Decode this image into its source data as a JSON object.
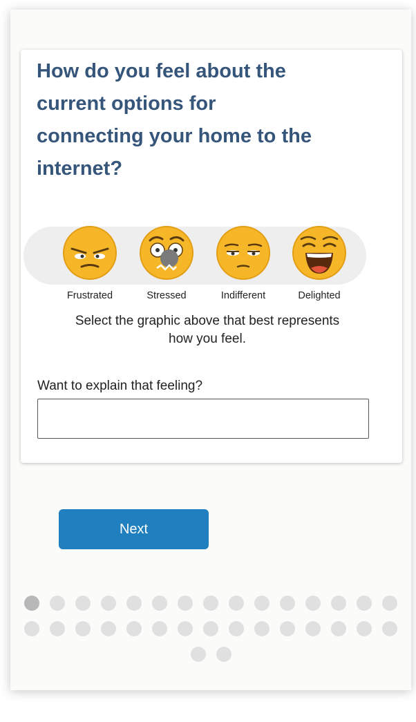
{
  "question": {
    "lines": [
      "How do you feel about the",
      "current options for",
      "connecting your home to the",
      "internet?"
    ]
  },
  "moods": [
    {
      "label": "Frustrated",
      "icon": "frustrated-face-icon"
    },
    {
      "label": "Stressed",
      "icon": "stressed-face-icon"
    },
    {
      "label": "Indifferent",
      "icon": "indifferent-face-icon"
    },
    {
      "label": "Delighted",
      "icon": "delighted-face-icon"
    }
  ],
  "instruction": {
    "line1": "Select the graphic above that best represents",
    "line2": "how you feel."
  },
  "explain": {
    "label": "Want to explain that feeling?",
    "value": ""
  },
  "next_button": {
    "label": "Next"
  },
  "progress": {
    "total_pages": 32,
    "current_page": 1
  },
  "colors": {
    "question_text": "#35557a",
    "button": "#1f7fbf",
    "emoji": "#f5b728",
    "dot": "#e0e0e0",
    "dot_active": "#b8b8b8"
  }
}
